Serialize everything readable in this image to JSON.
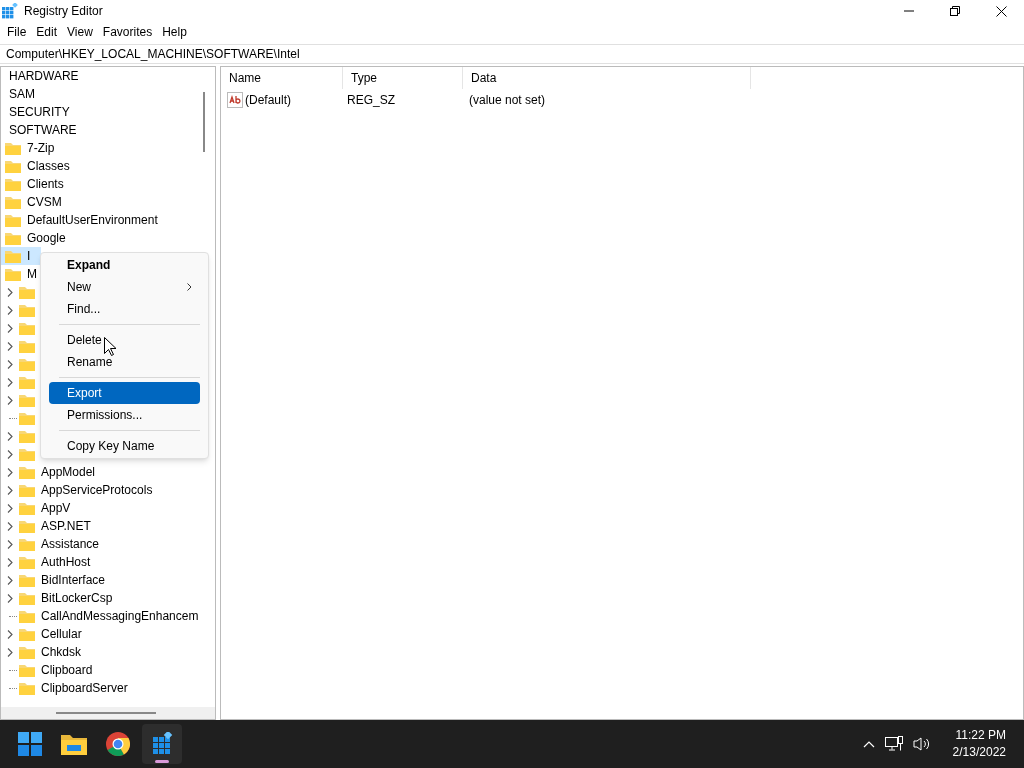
{
  "window": {
    "title": "Registry Editor"
  },
  "menu": [
    "File",
    "Edit",
    "View",
    "Favorites",
    "Help"
  ],
  "address": "Computer\\HKEY_LOCAL_MACHINE\\SOFTWARE\\Intel",
  "tree": [
    {
      "label": "HARDWARE",
      "selected": false
    },
    {
      "label": "SAM",
      "selected": false
    },
    {
      "label": "SECURITY",
      "selected": false
    },
    {
      "label": "SOFTWARE",
      "selected": false,
      "children": [
        {
          "label": "7-Zip",
          "selected": false
        },
        {
          "label": "Classes",
          "selected": false
        },
        {
          "label": "Clients",
          "selected": false
        },
        {
          "label": "CVSM",
          "selected": false
        },
        {
          "label": "DefaultUserEnvironment",
          "selected": false
        },
        {
          "label": "Google",
          "selected": false
        },
        {
          "label": "I",
          "selected": true
        },
        {
          "label": "M",
          "selected": false,
          "children": [
            {
              "expandable": true,
              "selected": false
            },
            {
              "expandable": true,
              "selected": false
            },
            {
              "expandable": true,
              "selected": false
            },
            {
              "expandable": true,
              "selected": false
            },
            {
              "expandable": true,
              "selected": false
            },
            {
              "expandable": true,
              "selected": false
            },
            {
              "expandable": true,
              "selected": false
            },
            {
              "expandable": false,
              "selected": false
            },
            {
              "expandable": true,
              "selected": false
            },
            {
              "expandable": true,
              "selected": false
            },
            {
              "label": "AppModel",
              "expandable": true,
              "selected": false
            },
            {
              "label": "AppServiceProtocols",
              "expandable": true,
              "selected": false
            },
            {
              "label": "AppV",
              "expandable": true,
              "selected": false
            },
            {
              "label": "ASP.NET",
              "expandable": true,
              "selected": false
            },
            {
              "label": "Assistance",
              "expandable": true,
              "selected": false
            },
            {
              "label": "AuthHost",
              "expandable": true,
              "selected": false
            },
            {
              "label": "BidInterface",
              "expandable": true,
              "selected": false
            },
            {
              "label": "BitLockerCsp",
              "expandable": true,
              "selected": false
            },
            {
              "label": "CallAndMessagingEnhancem",
              "expandable": false,
              "selected": false
            },
            {
              "label": "Cellular",
              "expandable": true,
              "selected": false
            },
            {
              "label": "Chkdsk",
              "expandable": true,
              "selected": false
            },
            {
              "label": "Clipboard",
              "expandable": false,
              "selected": false
            },
            {
              "label": "ClipboardServer",
              "expandable": false,
              "selected": false
            }
          ]
        }
      ]
    }
  ],
  "values": {
    "columns": [
      "Name",
      "Type",
      "Data"
    ],
    "rows": [
      {
        "name": "(Default)",
        "type": "REG_SZ",
        "data": "(value not set)"
      }
    ]
  },
  "context_menu": [
    {
      "kind": "item",
      "label": "Expand",
      "bold": true,
      "selected": false
    },
    {
      "kind": "submenu",
      "label": "New",
      "selected": false
    },
    {
      "kind": "item",
      "label": "Find...",
      "selected": false
    },
    {
      "kind": "separator"
    },
    {
      "kind": "item",
      "label": "Delete",
      "selected": false
    },
    {
      "kind": "item",
      "label": "Rename",
      "selected": false
    },
    {
      "kind": "separator"
    },
    {
      "kind": "item",
      "label": "Export",
      "selected": true
    },
    {
      "kind": "item",
      "label": "Permissions...",
      "selected": false
    },
    {
      "kind": "separator"
    },
    {
      "kind": "item",
      "label": "Copy Key Name",
      "selected": false
    }
  ],
  "taskbar": {
    "apps": [
      {
        "kind": "start",
        "active": false
      },
      {
        "kind": "explorer",
        "active": false
      },
      {
        "kind": "browser",
        "active": false
      },
      {
        "kind": "regedit",
        "active": true
      }
    ],
    "time": "11:22 PM",
    "date": "2/13/2022"
  }
}
